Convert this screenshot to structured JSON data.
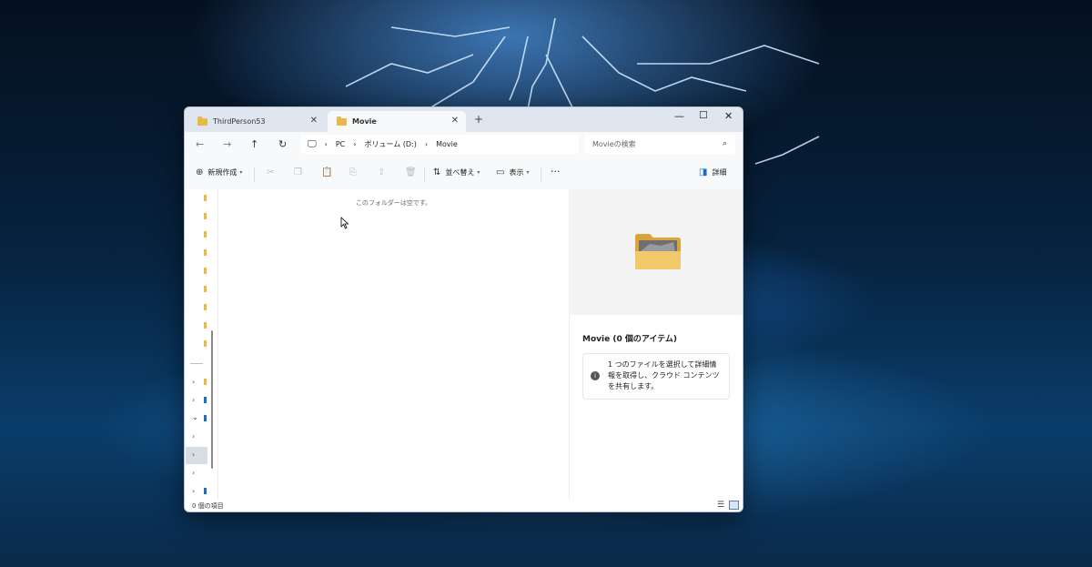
{
  "tabs": [
    {
      "label": "ThirdPerson53"
    },
    {
      "label": "Movie"
    }
  ],
  "address": {
    "crumbs": [
      "PC",
      "ボリューム (D:)",
      "Movie"
    ],
    "search_placeholder": "Movieの検索"
  },
  "toolbar": {
    "new_label": "新規作成",
    "sort_label": "並べ替え",
    "view_label": "表示",
    "details_label": "詳細"
  },
  "content": {
    "empty_text": "このフォルダーは空です。"
  },
  "details": {
    "title": "Movie (0 個のアイテム)",
    "info_text": "1 つのファイルを選択して詳細情報を取得し、クラウド コンテンツを共有します。"
  },
  "status": {
    "count": "0 個の項目"
  },
  "colors": {
    "folder": "#e8b84a",
    "accent": "#1a6fc4"
  }
}
